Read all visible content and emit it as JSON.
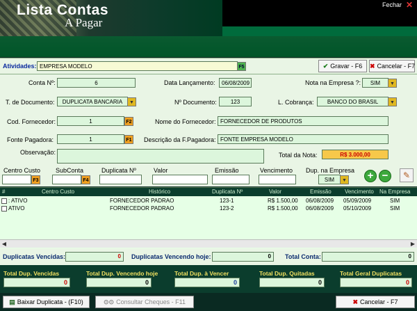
{
  "window": {
    "title_line1": "Lista Contas",
    "title_line2": "A  Pagar",
    "close_label": "Fechar",
    "close_icon": "close-icon"
  },
  "atividades": {
    "label": "Atividades:",
    "value": "EMPRESA MODELO",
    "key": "F5"
  },
  "actions": {
    "save_label": "Gravar - F6",
    "cancel_label": "Cancelar - F7"
  },
  "form": {
    "conta_label": "Conta Nº:",
    "conta_value": "6",
    "data_lanc_label": "Data Lançamento:",
    "data_lanc_value": "06/08/2009",
    "nota_label": "Nota na Empresa ?:",
    "nota_value": "SIM",
    "tdoc_label": "T. de Documento:",
    "tdoc_value": "DUPLICATA BANCARIA",
    "ndoc_label": "Nº Documento:",
    "ndoc_value": "123",
    "lcob_label": "L. Cobrança:",
    "lcob_value": "BANCO DO BRASIL",
    "codforn_label": "Cod. Fornecedor:",
    "codforn_value": "1",
    "codforn_key": "F2",
    "nomeforn_label": "Nome do Fornecedor:",
    "nomeforn_value": "FORNECEDOR DE PRODUTOS",
    "fonte_label": "Fonte Pagadora:",
    "fonte_value": "1",
    "fonte_key": "F1",
    "descfonte_label": "Descrição da F.Pagadora:",
    "descfonte_value": "FONTE EMPRESA MODELO",
    "obs_label": "Observação:",
    "obs_value": "",
    "totalnota_label": "Total da Nota:",
    "totalnota_value": "R$ 3.000,00"
  },
  "dup_entry": {
    "centro_label": "Centro Custo",
    "centro_key": "F3",
    "subconta_label": "SubConta",
    "subconta_key": "F4",
    "duplicata_label": "Duplicata Nº",
    "valor_label": "Valor",
    "emissao_label": "Emissão",
    "vencimento_label": "Vencimento",
    "dupemp_label": "Dup. na Empresa",
    "dupemp_value": "SIM"
  },
  "grid": {
    "columns": [
      "#",
      "Centro Custo",
      "Histórico",
      "Duplicata Nº",
      "Valor",
      "Emissão",
      "Vencimento",
      "Na Empresa"
    ],
    "rows": [
      {
        "centro": ": ATIVO",
        "historico": "FORNECEDOR PADRAO",
        "duplicata": "123-1",
        "valor": "R$ 1.500,00",
        "emissao": "06/08/2009",
        "vencimento": "05/09/2009",
        "empresa": "SIM"
      },
      {
        "centro": "ATIVO",
        "historico": "FORNECEDOR PADRAO",
        "duplicata": "123-2",
        "valor": "R$ 1.500,00",
        "emissao": "06/08/2009",
        "vencimento": "05/10/2009",
        "empresa": "SIM"
      }
    ]
  },
  "totals_row": {
    "vencidas_label": "Duplicatas Vencidas:",
    "vencidas_value": "0",
    "vencendo_label": "Duplicatas Vencendo hoje:",
    "vencendo_value": "0",
    "conta_label": "Total Conta:",
    "conta_value": "0"
  },
  "summary": {
    "items": [
      {
        "label": "Total Dup. Vencidas",
        "value": "0"
      },
      {
        "label": "Total Dup. Vencendo hoje",
        "value": "0"
      },
      {
        "label": "Total Dup. à Vencer",
        "value": "0"
      },
      {
        "label": "Total Dup. Quitadas",
        "value": "0"
      },
      {
        "label": "Total Geral Duplicatas",
        "value": "0"
      }
    ]
  },
  "footer": {
    "baixar_label": "Baixar Duplicata - (F10)",
    "consultar_label": "Consultar Cheques - F11",
    "cancel_label": "Cancelar - F7"
  }
}
